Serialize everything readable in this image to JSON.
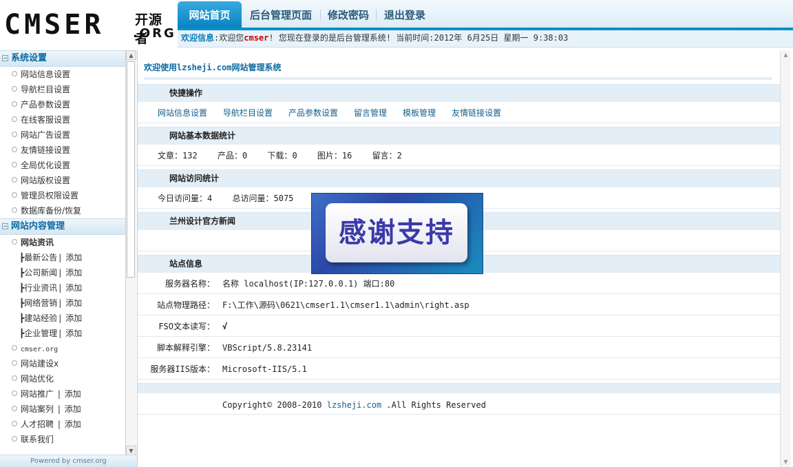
{
  "logo": {
    "main": "CMSER",
    "cn": "开源者",
    "org": ".ORG"
  },
  "topnav": {
    "tabs": [
      {
        "label": "网站首页"
      },
      {
        "label": "后台管理页面"
      },
      {
        "label": "修改密码"
      },
      {
        "label": "退出登录"
      }
    ]
  },
  "welcome": {
    "label": "欢迎信息",
    "prefix": ":欢迎您",
    "user": "cmser",
    "suffix": "! 您现在登录的是后台管理系统! 当前时间:2012年 6月25日 星期一 9:38:03"
  },
  "sidebar": {
    "cat1": "系统设置",
    "items1": [
      "网站信息设置",
      "导航栏目设置",
      "产品参数设置",
      "在线客服设置",
      "网站广告设置",
      "友情链接设置",
      "全局优化设置",
      "网站版权设置",
      "管理员权限设置",
      "数据库备份/恢复"
    ],
    "cat2": "网站内容管理",
    "subhead": "网站资讯",
    "subs": [
      "┣最新公告",
      "┣公司新闻",
      "┣行业资讯",
      "┣网络营销",
      "┣建站经验",
      "┣企业管理"
    ],
    "add": "添加",
    "items2": [
      {
        "label": "cmser.org",
        "add": ""
      },
      {
        "label": "网站建设x",
        "add": ""
      },
      {
        "label": "网站优化",
        "add": ""
      },
      {
        "label": "网站推广",
        "add": "添加"
      },
      {
        "label": "网站案列",
        "add": "添加"
      },
      {
        "label": "人才招聘",
        "add": "添加"
      },
      {
        "label": "联系我们",
        "add": ""
      }
    ],
    "powered": "Powered by cmser.org"
  },
  "main": {
    "title": "欢迎使用lzsheji.com网站管理系统",
    "sec_quick": "快捷操作",
    "quick_links": [
      "网站信息设置",
      "导航栏目设置",
      "产品参数设置",
      "留言管理",
      "模板管理",
      "友情链接设置"
    ],
    "sec_stats": "网站基本数据统计",
    "stats": [
      {
        "label": "文章：",
        "value": "132"
      },
      {
        "label": "产品：",
        "value": "0"
      },
      {
        "label": "下载：",
        "value": "0"
      },
      {
        "label": "图片：",
        "value": "16"
      },
      {
        "label": "留言：",
        "value": "2"
      }
    ],
    "sec_visits": "网站访问统计",
    "visits_today_label": "今日访问量：",
    "visits_today": "4",
    "visits_total_label": "总访问量：",
    "visits_total": "5075",
    "sec_news": "兰州设计官方新闻",
    "sec_site": "站点信息",
    "site": [
      {
        "label": "服务器名称：",
        "value": "名称 localhost(IP:127.0.0.1) 端口:80"
      },
      {
        "label": "站点物理路径：",
        "value": "F:\\工作\\源码\\0621\\cmser1.1\\cmser1.1\\admin\\right.asp"
      },
      {
        "label": "FSO文本读写：",
        "value": "√"
      },
      {
        "label": "脚本解释引擎：",
        "value": "VBScript/5.8.23141"
      },
      {
        "label": "服务器IIS版本：",
        "value": "Microsoft-IIS/5.1"
      }
    ],
    "copyright_pre": "Copyright© 2008-2010 ",
    "copyright_link": "lzsheji.com",
    "copyright_post": " .All Rights Reserved"
  },
  "overlay": {
    "text": "感谢支持"
  }
}
